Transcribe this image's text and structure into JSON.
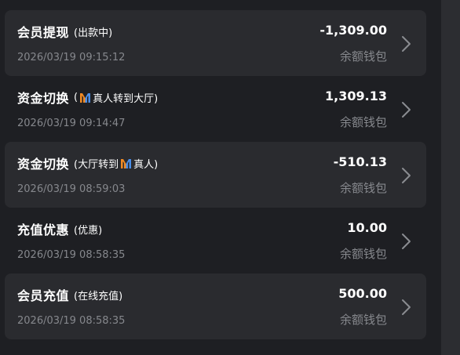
{
  "records": [
    {
      "title": "会员提现",
      "sub_before": "(出款中)",
      "sub_brand": "",
      "sub_after": "",
      "brand_position": "none",
      "time": "2026/03/19 09:15:12",
      "amount": "-1,309.00",
      "wallet": "余额钱包",
      "shaded": true
    },
    {
      "title": "资金切换",
      "sub_before": "(",
      "sub_brand": "真人转到大厅)",
      "sub_after": "",
      "brand_position": "after-open",
      "time": "2026/03/19 09:14:47",
      "amount": "1,309.13",
      "wallet": "余额钱包",
      "shaded": false
    },
    {
      "title": "资金切换",
      "sub_before": "(大厅转到",
      "sub_brand": "真人)",
      "sub_after": "",
      "brand_position": "after-open",
      "time": "2026/03/19 08:59:03",
      "amount": "-510.13",
      "wallet": "余额钱包",
      "shaded": true
    },
    {
      "title": "充值优惠",
      "sub_before": "(优惠)",
      "sub_brand": "",
      "sub_after": "",
      "brand_position": "none",
      "time": "2026/03/19 08:58:35",
      "amount": "10.00",
      "wallet": "余额钱包",
      "shaded": false
    },
    {
      "title": "会员充值",
      "sub_before": "(在线充值)",
      "sub_brand": "",
      "sub_after": "",
      "brand_position": "none",
      "time": "2026/03/19 08:58:35",
      "amount": "500.00",
      "wallet": "余额钱包",
      "shaded": true
    }
  ],
  "icons": {
    "chevron": "chevron-right-icon",
    "brand": "brand-logo-icon"
  },
  "colors": {
    "background": "#1e1f23",
    "card": "#2a2b2f",
    "gutter": "#2c2d31",
    "text_primary": "#ffffff",
    "text_secondary": "#86888d",
    "brand_orange": "#f08a24",
    "brand_blue": "#4a8ee8"
  }
}
